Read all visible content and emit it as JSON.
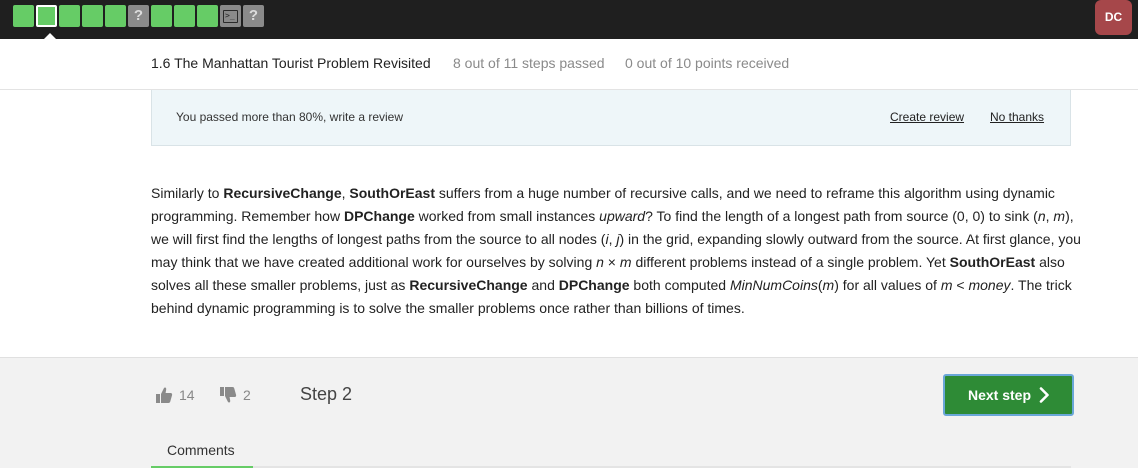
{
  "topbar": {
    "steps": [
      {
        "kind": "done"
      },
      {
        "kind": "done-active"
      },
      {
        "kind": "done"
      },
      {
        "kind": "done"
      },
      {
        "kind": "done"
      },
      {
        "kind": "quiz",
        "glyph": "?"
      },
      {
        "kind": "done"
      },
      {
        "kind": "done"
      },
      {
        "kind": "done"
      },
      {
        "kind": "code",
        "glyph": ">_"
      },
      {
        "kind": "quiz",
        "glyph": "?"
      }
    ],
    "user_initials": "DC",
    "colors": {
      "bar": "#1f1f1f",
      "step_done": "#66cc66",
      "step_locked": "#8a8a8a",
      "avatar": "#a6474a"
    }
  },
  "lesson": {
    "title": "1.6 The Manhattan Tourist Problem Revisited",
    "progress": "8 out of 11 steps passed",
    "points": "0 out of 10 points  received"
  },
  "review": {
    "message": "You passed more than 80%, write a review",
    "create_label": "Create review",
    "no_thanks_label": "No thanks"
  },
  "article": {
    "p1_t1": "Similarly to ",
    "p1_b1": "RecursiveChange",
    "p1_t2": ", ",
    "p1_b2": "SouthOrEast",
    "p1_t3": " suffers from a huge number of recursive calls, and we need to reframe this algorithm using dynamic programming. Remember how ",
    "p1_b3": "DPChange",
    "p1_t4": " worked from small instances ",
    "p1_i1": "upward",
    "p1_t5": "? To find the length of a longest path from source (0, 0) to sink (",
    "p1_i2": "n",
    "p1_t6": ", ",
    "p1_i3": "m",
    "p1_t7": "), we will first find the lengths of longest paths from the source to all nodes (",
    "p1_i4": "i",
    "p1_t8": ", ",
    "p1_i5": "j",
    "p1_t9": ") in the grid, expanding slowly outward from the source. At first glance, you may think that we have created additional work for ourselves by solving ",
    "p1_i6": "n",
    "p1_t10": " × ",
    "p1_i7": "m",
    "p1_t11": " different problems instead of a single problem. Yet ",
    "p1_b4": "SouthOrEast",
    "p1_t12": " also solves all these smaller problems, just as ",
    "p1_b5": "RecursiveChange",
    "p1_t13": " and ",
    "p1_b6": "DPChange",
    "p1_t14": " both computed ",
    "p1_i8": "MinNumCoins",
    "p1_t15": "(",
    "p1_i9": "m",
    "p1_t16": ") for all values of ",
    "p1_i10": "m",
    "p1_t17": " < ",
    "p1_i11": "money",
    "p1_t18": ". The trick behind dynamic programming is to solve the smaller problems once rather than billions of times."
  },
  "footer": {
    "likes": "14",
    "dislikes": "2",
    "step_label": "Step 2",
    "next_label": "Next step",
    "comments_label": "Comments",
    "colors": {
      "next_bg": "#2e8b36",
      "next_border": "#6aa7d8",
      "tab_accent": "#66cc66"
    }
  }
}
